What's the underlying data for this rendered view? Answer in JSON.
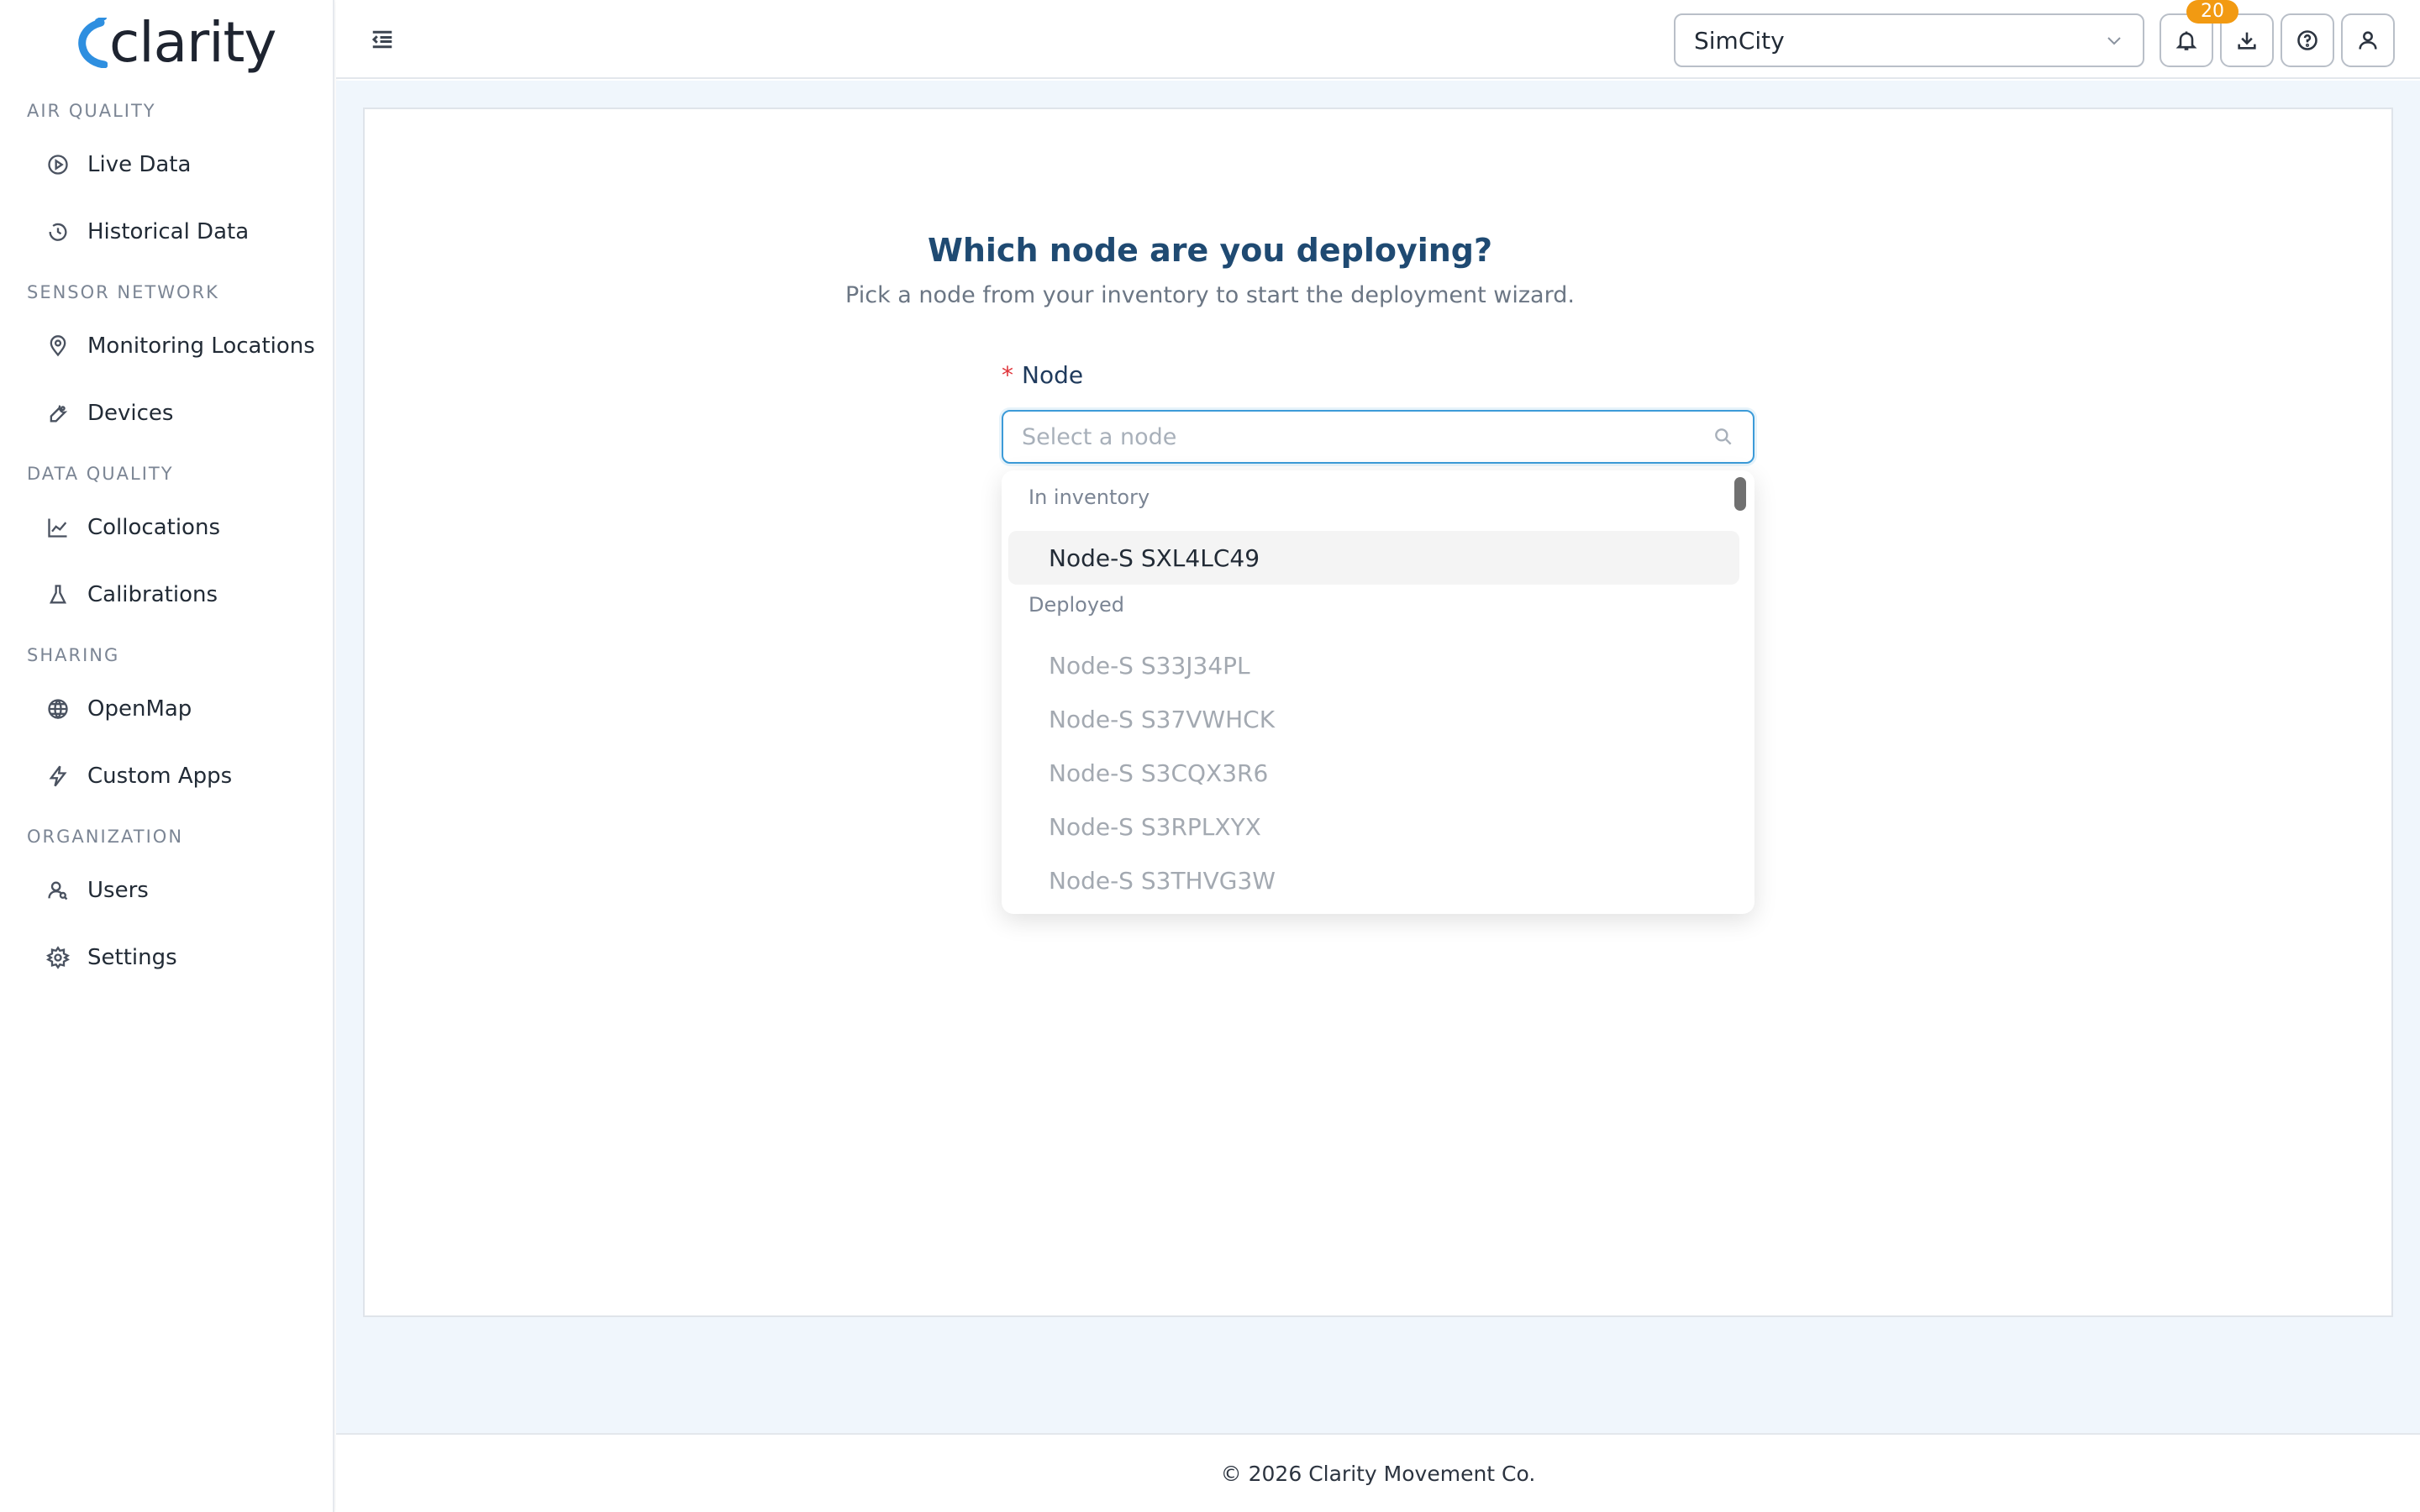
{
  "app": {
    "logo_text": "clarity"
  },
  "sidebar": {
    "sections": [
      {
        "label": "AIR QUALITY",
        "items": [
          {
            "label": "Live Data",
            "icon": "play-circle-icon"
          },
          {
            "label": "Historical Data",
            "icon": "clock-icon"
          }
        ]
      },
      {
        "label": "SENSOR NETWORK",
        "items": [
          {
            "label": "Monitoring Locations",
            "icon": "location-pin-icon"
          },
          {
            "label": "Devices",
            "icon": "wrench-icon"
          }
        ]
      },
      {
        "label": "DATA QUALITY",
        "items": [
          {
            "label": "Collocations",
            "icon": "line-chart-icon"
          },
          {
            "label": "Calibrations",
            "icon": "flask-icon"
          }
        ]
      },
      {
        "label": "SHARING",
        "items": [
          {
            "label": "OpenMap",
            "icon": "globe-icon"
          },
          {
            "label": "Custom Apps",
            "icon": "lightning-icon"
          }
        ]
      },
      {
        "label": "ORGANIZATION",
        "items": [
          {
            "label": "Users",
            "icon": "users-icon"
          },
          {
            "label": "Settings",
            "icon": "gear-icon"
          }
        ]
      }
    ]
  },
  "header": {
    "org_select": {
      "value": "SimCity"
    },
    "notifications": {
      "count": "20"
    }
  },
  "wizard": {
    "title": "Which node are you deploying?",
    "subtitle": "Pick a node from your inventory to start the deployment wizard.",
    "field_label": "Node",
    "required_mark": "*",
    "placeholder": "Select a node"
  },
  "dropdown": {
    "groups": [
      {
        "label": "In inventory",
        "options": [
          "Node-S SXL4LC49"
        ]
      },
      {
        "label": "Deployed",
        "options": [
          "Node-S S33J34PL",
          "Node-S S37VWHCK",
          "Node-S S3CQX3R6",
          "Node-S S3RPLXYX",
          "Node-S S3THVG3W"
        ]
      }
    ]
  },
  "footer": {
    "text": "© 2026 Clarity Movement Co."
  },
  "colors": {
    "accent": "#3c9bd8",
    "title": "#1f4a72",
    "badge": "#f29a12",
    "background": "#f0f6fc"
  }
}
